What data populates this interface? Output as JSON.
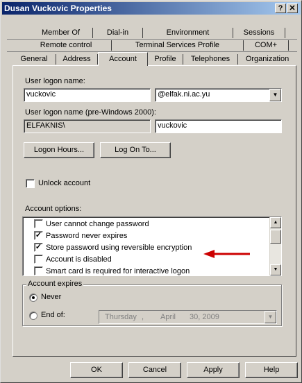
{
  "window": {
    "title": "Dusan Vuckovic Properties",
    "help_glyph": "?",
    "close_glyph": "✕"
  },
  "tabs": {
    "row1": [
      "Member Of",
      "Dial-in",
      "Environment",
      "Sessions"
    ],
    "row2": [
      "Remote control",
      "Terminal Services Profile",
      "COM+"
    ],
    "row3": [
      "General",
      "Address",
      "Account",
      "Profile",
      "Telephones",
      "Organization"
    ],
    "active": "Account"
  },
  "account": {
    "logon_name_label": "User logon name:",
    "logon_name_value": "vuckovic",
    "domain_suffix": "@elfak.ni.ac.yu",
    "pre2000_label": "User logon name (pre-Windows 2000):",
    "pre2000_domain": "ELFAKNIS\\",
    "pre2000_user": "vuckovic",
    "logon_hours_button": "Logon Hours...",
    "log_on_to_button": "Log On To...",
    "unlock_label": "Unlock account",
    "options_label": "Account options:",
    "options": [
      {
        "label": "User cannot change password",
        "checked": false
      },
      {
        "label": "Password never expires",
        "checked": true
      },
      {
        "label": "Store password using reversible encryption",
        "checked": true
      },
      {
        "label": "Account is disabled",
        "checked": false
      },
      {
        "label": "Smart card is required for interactive logon",
        "checked": false
      }
    ],
    "expires_label": "Account expires",
    "never_label": "Never",
    "end_of_label": "End of:",
    "date_weekday": "Thursday",
    "date_month": "April",
    "date_day_year": "30, 2009"
  },
  "footer": {
    "ok": "OK",
    "cancel": "Cancel",
    "apply": "Apply",
    "help": "Help"
  },
  "colors": {
    "title_start": "#0a246a",
    "title_end": "#a6caf0",
    "face": "#d4d0c8",
    "arrow": "#cc0000"
  }
}
